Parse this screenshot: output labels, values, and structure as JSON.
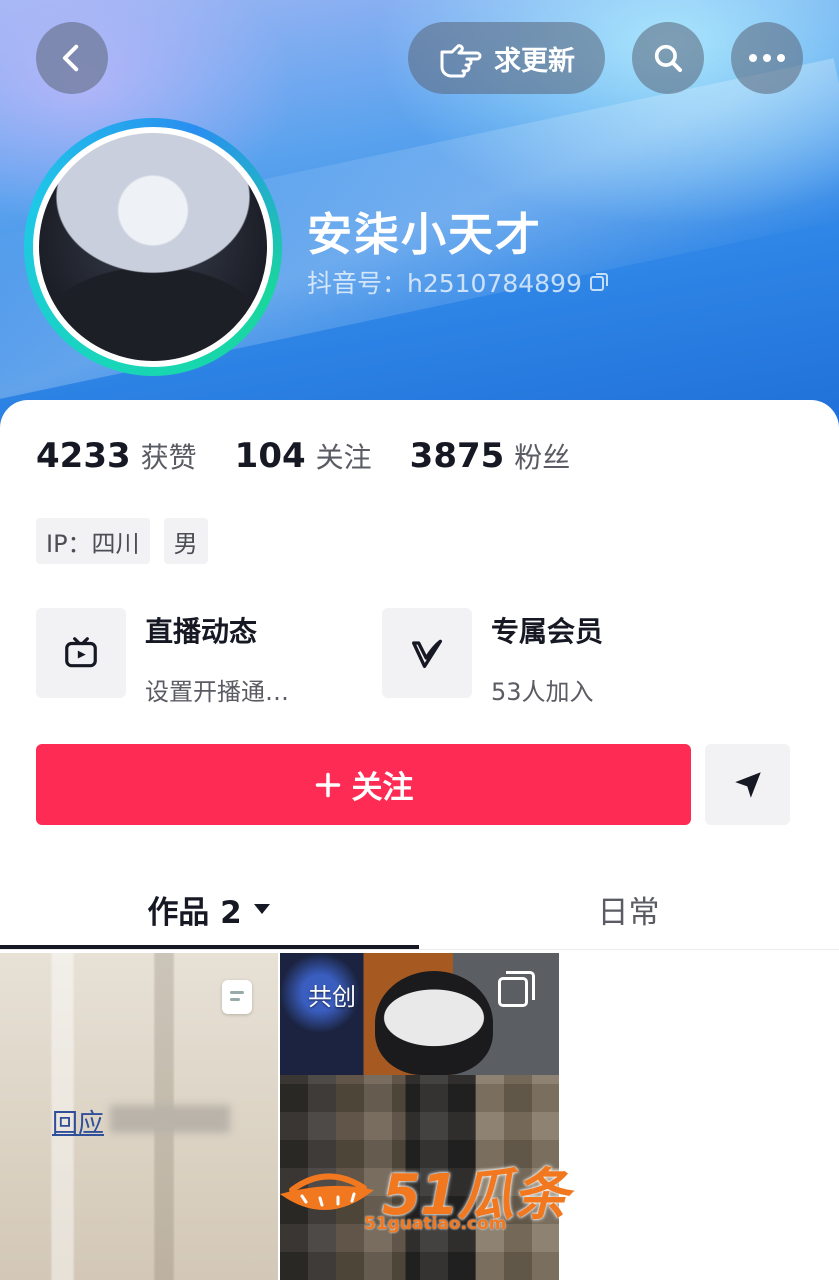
{
  "header": {
    "update_label": "求更新",
    "nickname": "安柒小天才",
    "douyin_id": "抖音号：h2510784899"
  },
  "stats": [
    {
      "value": "4233",
      "label": "获赞"
    },
    {
      "value": "104",
      "label": "关注"
    },
    {
      "value": "3875",
      "label": "粉丝"
    }
  ],
  "tags": [
    "IP：四川",
    "男"
  ],
  "features": {
    "live": {
      "title": "直播动态",
      "subtitle": "设置开播通…"
    },
    "member": {
      "title": "专属会员",
      "subtitle": "53人加入"
    }
  },
  "actions": {
    "follow_label": "关注"
  },
  "tabs": {
    "works": "作品 2",
    "daily": "日常"
  },
  "grid": {
    "reply_text": "回应",
    "cocreate_badge": "共创"
  },
  "watermark": {
    "brand": "51瓜条",
    "url": "51guatiao.com"
  },
  "colors": {
    "follow_button": "#fe2c55",
    "avatar_ring": "#18d6b9",
    "banner": "#2f86e6"
  }
}
